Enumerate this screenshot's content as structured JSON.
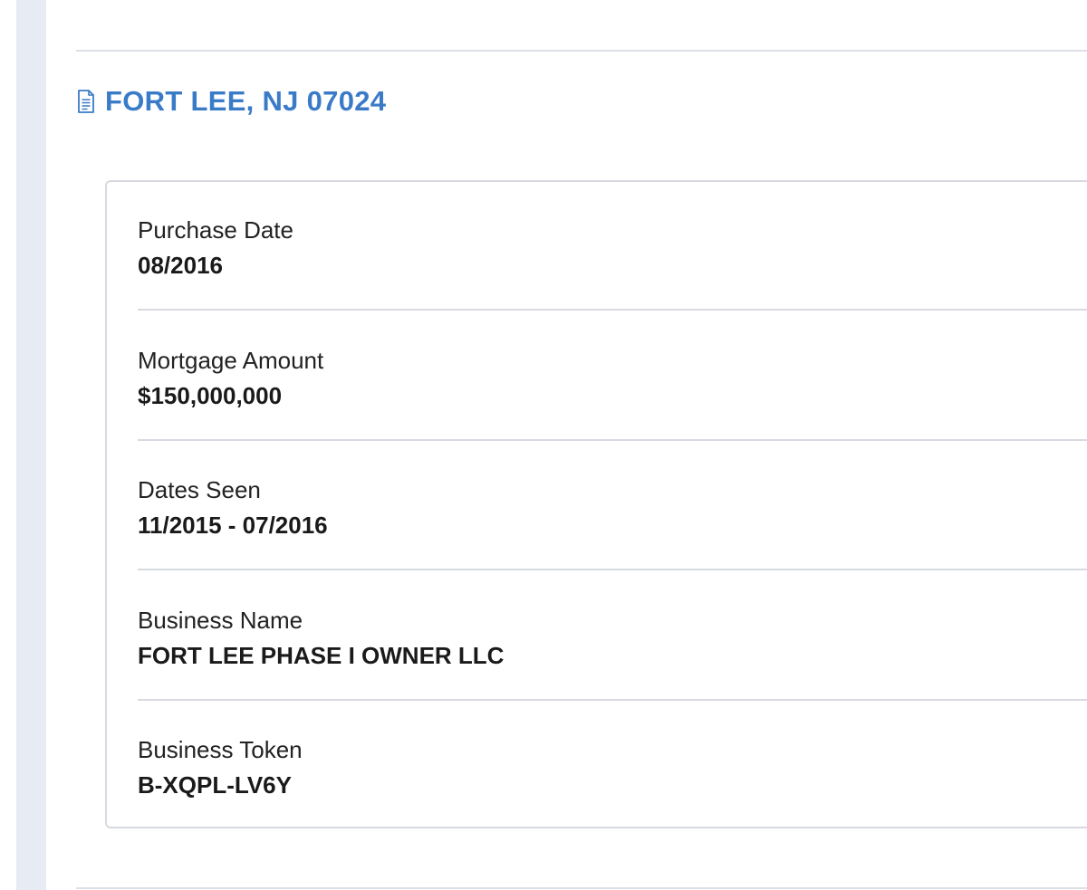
{
  "header": {
    "title": "FORT LEE, NJ 07024",
    "icon": "document-icon",
    "accent_color": "#3a7bc8"
  },
  "record": {
    "fields": [
      {
        "label": "Purchase Date",
        "value": "08/2016"
      },
      {
        "label": "Mortgage Amount",
        "value": "$150,000,000"
      },
      {
        "label": "Dates Seen",
        "value": "11/2015 - 07/2016"
      },
      {
        "label": "Business Name",
        "value": "FORT LEE PHASE I OWNER LLC"
      },
      {
        "label": "Business Token",
        "value": "B-XQPL-LV6Y"
      }
    ]
  }
}
